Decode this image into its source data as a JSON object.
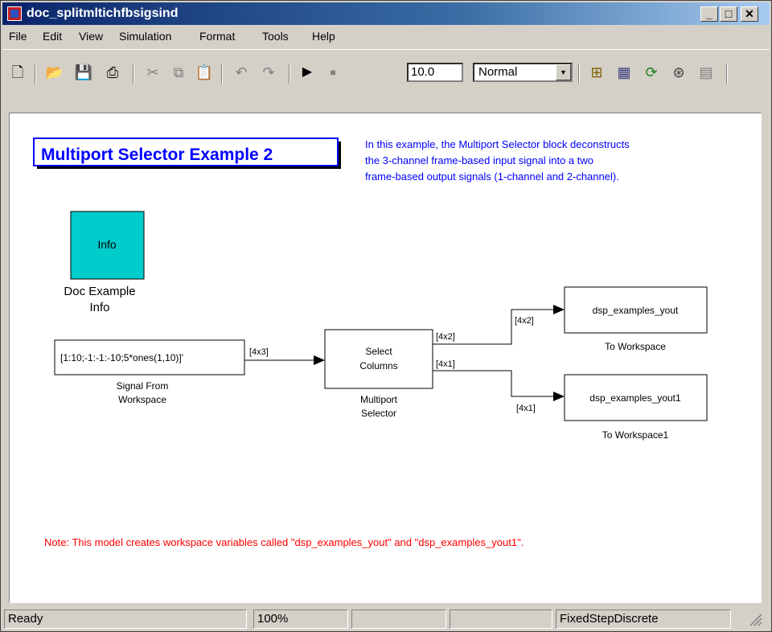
{
  "window": {
    "title": "doc_splitmltichfbsigsind"
  },
  "menu": [
    "File",
    "Edit",
    "View",
    "Simulation",
    "Format",
    "Tools",
    "Help"
  ],
  "toolbar": {
    "stop_time": "10.0",
    "sim_mode": "Normal"
  },
  "diagram": {
    "heading": "Multiport Selector Example 2",
    "description_lines": [
      "In this example, the Multiport Selector block deconstructs",
      "the 3-channel frame-based input signal into a two",
      "frame-based output signals (1-channel and 2-channel)."
    ],
    "info_block": {
      "label": "Info",
      "caption_lines": [
        "Doc Example",
        "Info"
      ]
    },
    "signal_block": {
      "value": "[1:10;-1:-1:-10;5*ones(1,10)]'",
      "caption_lines": [
        "Signal From",
        "Workspace"
      ]
    },
    "selector_block": {
      "label_lines": [
        "Select",
        "Columns"
      ],
      "caption_lines": [
        "Multiport",
        "Selector"
      ]
    },
    "workspace1": {
      "value": "dsp_examples_yout",
      "caption": "To Workspace"
    },
    "workspace2": {
      "value": "dsp_examples_yout1",
      "caption": "To Workspace1"
    },
    "signal_dims": {
      "input": "[4x3]",
      "out1_start": "[4x2]",
      "out2_start": "[4x1]",
      "out1_end": "[4x2]",
      "out2_end": "[4x1]"
    },
    "note": "Note: This model creates workspace variables called \"dsp_examples_yout\" and \"dsp_examples_yout1\".",
    "colors": {
      "heading": "#0000ff",
      "description": "#0000ff",
      "note": "#ff0000",
      "info_fill": "#00cccc"
    }
  },
  "status": {
    "state": "Ready",
    "zoom": "100%",
    "solver": "FixedStepDiscrete"
  }
}
